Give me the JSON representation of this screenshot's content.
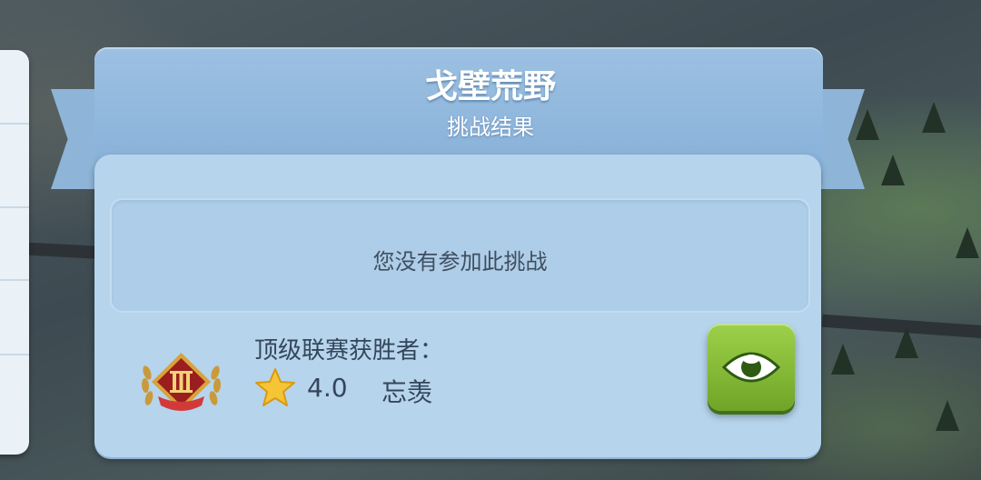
{
  "window": {
    "title": "戈壁荒野",
    "subtitle": "挑战结果"
  },
  "message": "您没有参加此挑战",
  "winner": {
    "label": "顶级联赛获胜者：",
    "rating": "4.0",
    "name": "忘羡",
    "league_badge_numeral": "III"
  },
  "icons": {
    "view": "eye-icon",
    "rating": "star-icon",
    "badge": "league-badge-icon"
  },
  "colors": {
    "header": "#8eb5d8",
    "panel": "#b6d4ec",
    "button_green": "#7fb832",
    "text": "#34465a"
  }
}
